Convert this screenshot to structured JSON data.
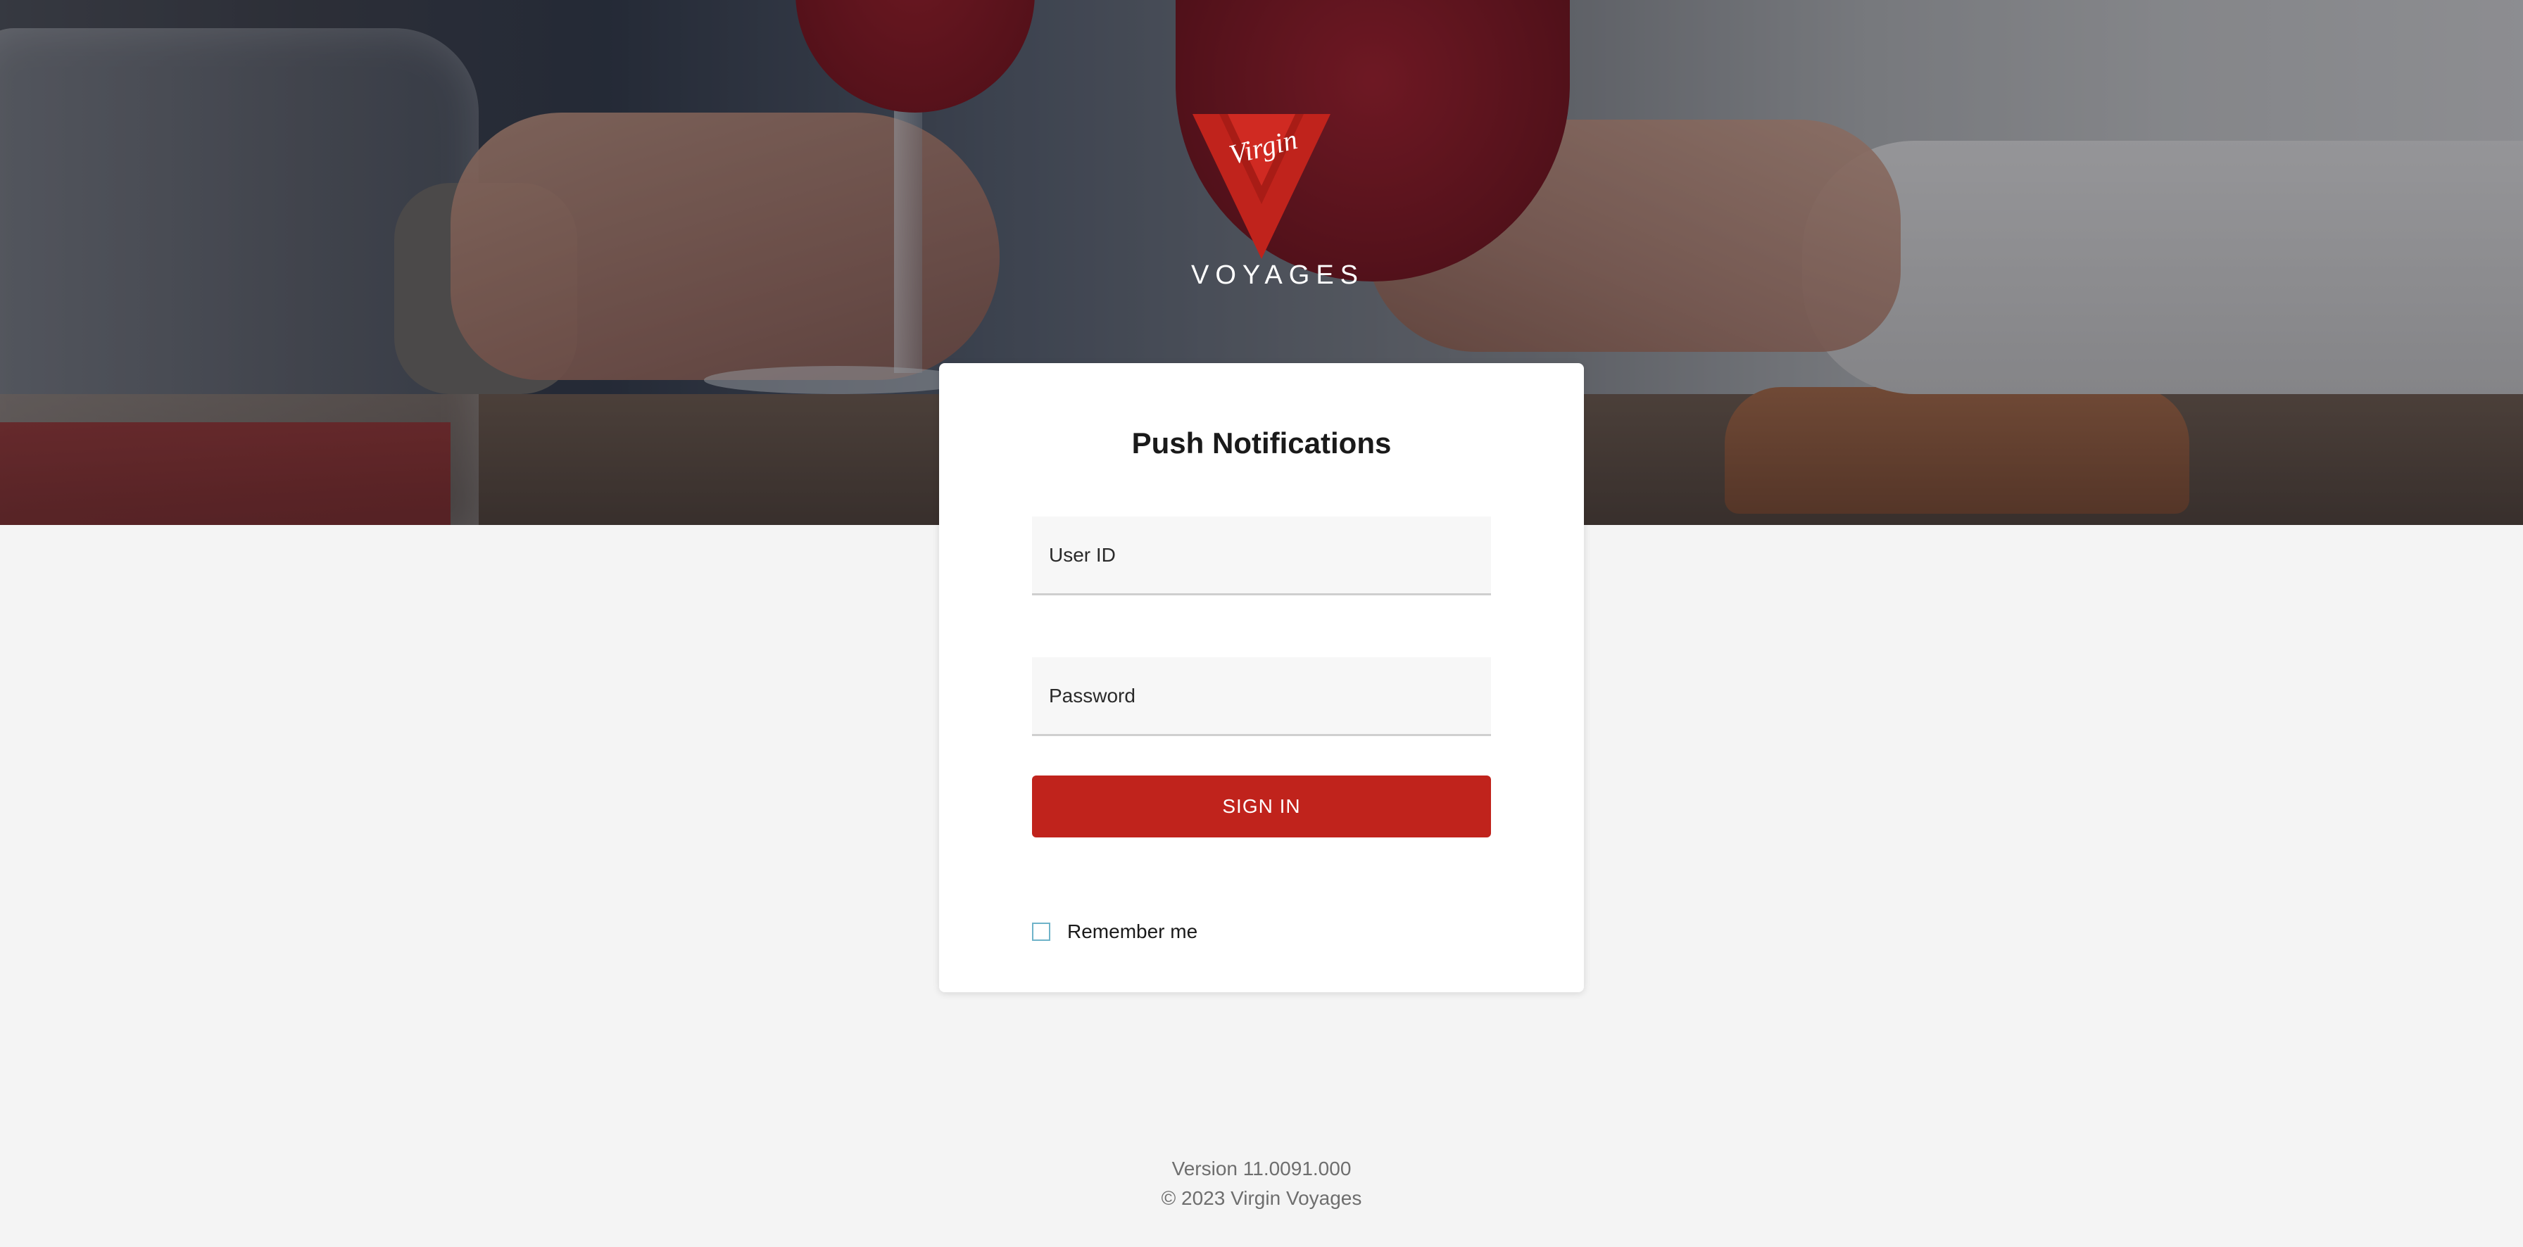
{
  "brand": {
    "logo_script": "Virgin",
    "logo_word": "VOYAGES",
    "colors": {
      "accent": "#c0231c",
      "background": "#f4f4f4",
      "card": "#ffffff",
      "checkbox_border": "#6fb3c9"
    }
  },
  "login": {
    "title": "Push Notifications",
    "user_id": {
      "placeholder": "User ID",
      "value": ""
    },
    "password": {
      "placeholder": "Password",
      "value": ""
    },
    "submit_label": "SIGN IN",
    "remember_label": "Remember me",
    "remember_checked": false
  },
  "footer": {
    "version": "Version 11.0091.000",
    "copyright": "© 2023 Virgin Voyages"
  }
}
